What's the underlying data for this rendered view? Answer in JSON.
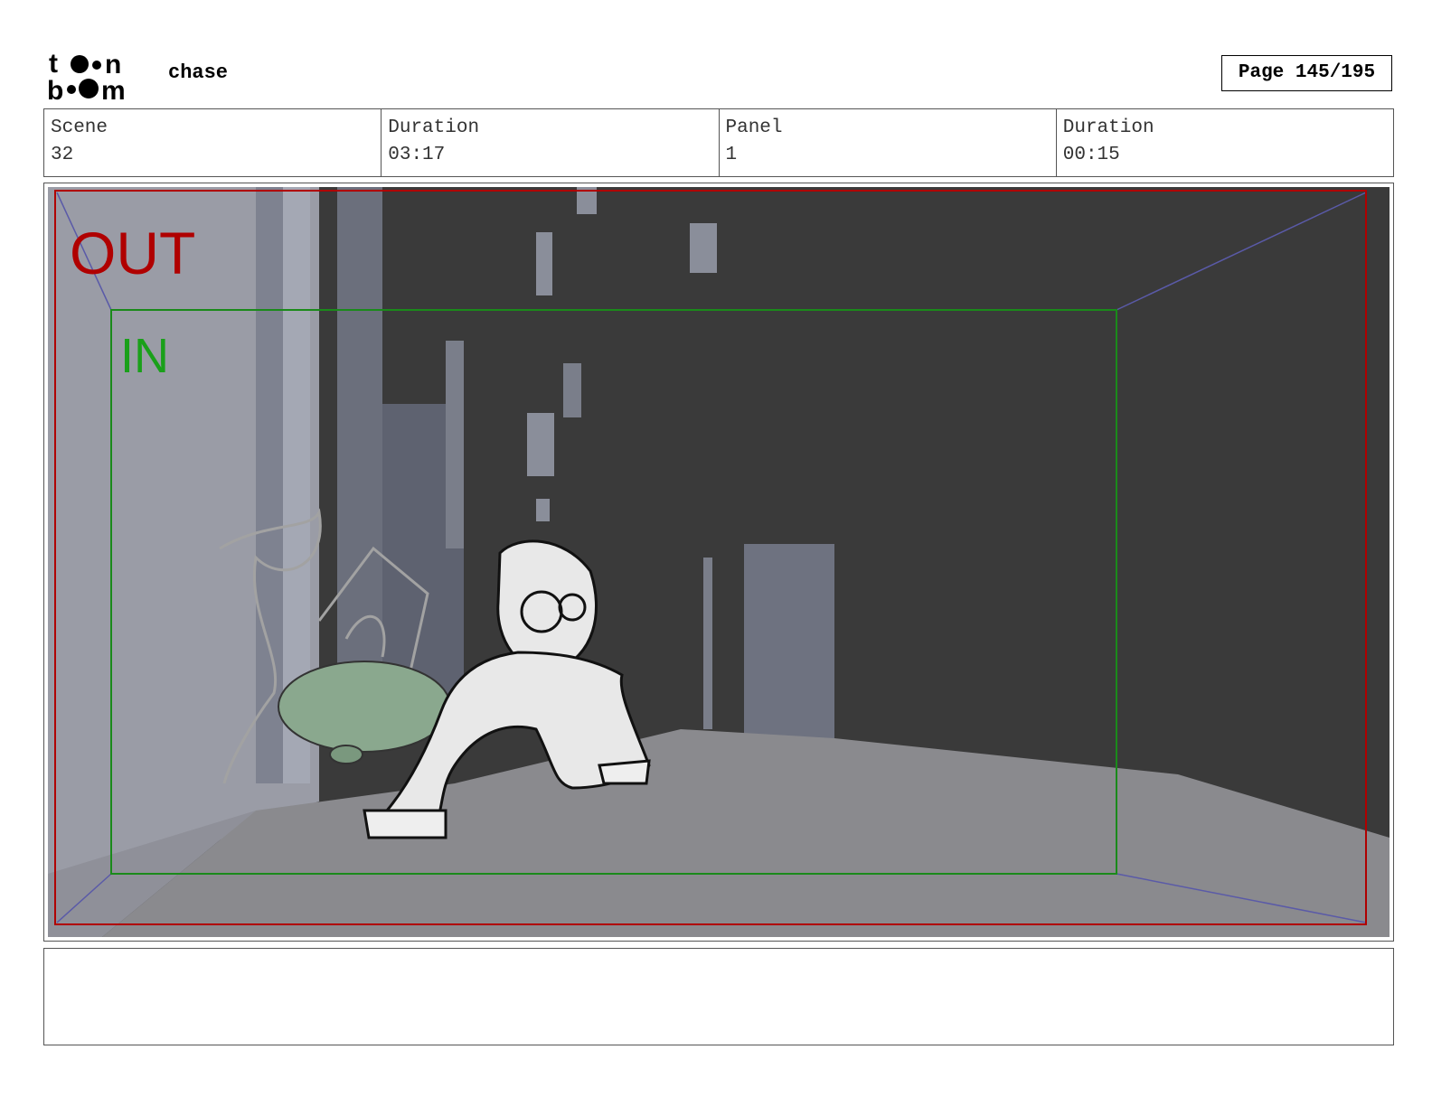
{
  "header": {
    "logo_text": "toon boom",
    "project_title": "chase",
    "page_label": "Page 145/195"
  },
  "info": {
    "scene_label": "Scene",
    "scene_value": "32",
    "scene_duration_label": "Duration",
    "scene_duration_value": "03:17",
    "panel_label": "Panel",
    "panel_value": "1",
    "panel_duration_label": "Duration",
    "panel_duration_value": "00:15"
  },
  "panel": {
    "out_label": "OUT",
    "in_label": "IN",
    "colors": {
      "out_frame": "#b00000",
      "in_frame": "#1a8a1a",
      "perspective": "#5a5aa8",
      "wall_dark": "#3a3a3a",
      "floor": "#8a8a8e",
      "bag": "#8aa88e"
    }
  },
  "notes": {
    "text": ""
  }
}
